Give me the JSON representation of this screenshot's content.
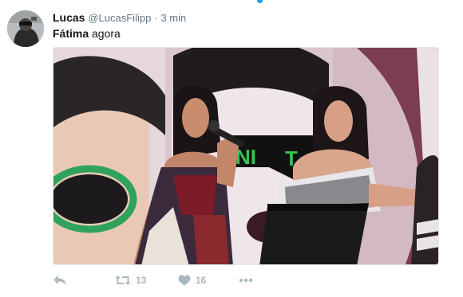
{
  "tweet": {
    "author_name": "Lucas",
    "handle": "@LucasFilipp",
    "separator": "·",
    "time": "3 min",
    "text_bold": "Fátima",
    "text_rest": " agora"
  },
  "actions": {
    "retweet_count": "13",
    "like_count": "16"
  },
  "icons": [
    "reply-icon",
    "retweet-icon",
    "like-icon",
    "more-icon"
  ],
  "colors": {
    "action_gray": "#aab8c2",
    "handle_gray": "#657786",
    "accent_blue": "#1da1f2"
  }
}
